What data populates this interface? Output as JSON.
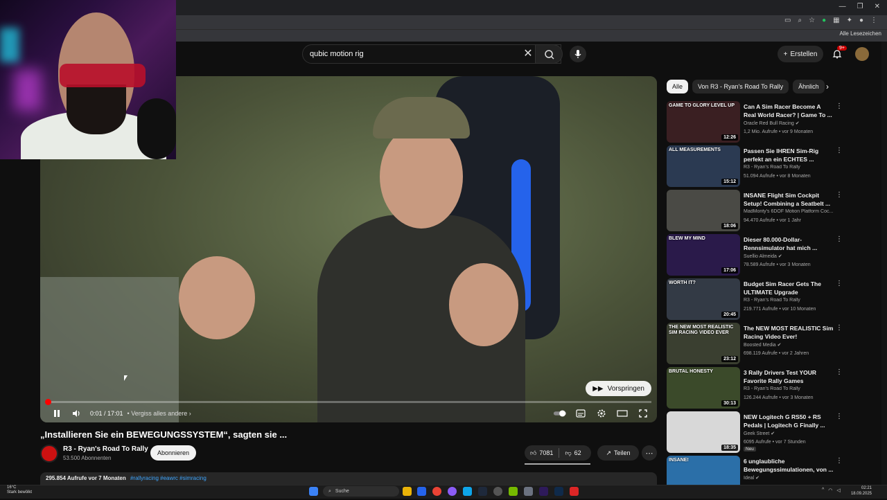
{
  "browser": {
    "bookmarks_label": "Alle Lesezeichen"
  },
  "header": {
    "search_value": "qubic motion rig",
    "create_label": "Erstellen",
    "notifications_badge": "9+"
  },
  "player": {
    "skip_label": "Vorspringen",
    "time": "0:01 / 17:01",
    "chapter": "• Vergiss alles andere",
    "progress": 0.001
  },
  "video": {
    "title": "„Installieren Sie ein BEWEGUNGSSYSTEM“, sagten sie ...",
    "channel_name": "R3 - Ryan's Road To Rally",
    "subscribers": "53.500 Abonnenten",
    "subscribe_label": "Abonnieren",
    "likes": "7081",
    "dislikes": "62",
    "share_label": "Teilen",
    "views": "295.854 Aufrufe  vor 7 Monaten",
    "tags": "#rallyracing #eawrc #simracing"
  },
  "chips": [
    {
      "label": "Alle",
      "active": true
    },
    {
      "label": "Von R3 - Ryan's Road To Rally",
      "active": false
    },
    {
      "label": "Ähnlich",
      "active": false
    }
  ],
  "recommendations": [
    {
      "title": "Can A Sim Racer Become A Real World Racer? | Game To ...",
      "channel": "Oracle Red Bull Racing",
      "verified": true,
      "meta": "1,2 Mio. Aufrufe • vor 9 Monaten",
      "duration": "12:26",
      "thumb_text": "GAME TO GLORY LEVEL UP",
      "thumb_color": "#3a1f22",
      "new": ""
    },
    {
      "title": "Passen Sie IHREN Sim-Rig perfekt an ein ECHTES ...",
      "channel": "R3 - Ryan's Road To Rally",
      "verified": false,
      "meta": "51.094 Aufrufe • vor 8 Monaten",
      "duration": "15:12",
      "thumb_text": "ALL MEASUREMENTS",
      "thumb_color": "#2b3a52",
      "new": ""
    },
    {
      "title": "INSANE Flight Sim Cockpit Setup! Combining a Seatbelt ...",
      "channel": "MadMonty's 6DOF Motion Platform Coc...",
      "verified": false,
      "meta": "94.470 Aufrufe • vor 1 Jahr",
      "duration": "18:06",
      "thumb_text": "",
      "thumb_color": "#4a4a45",
      "new": ""
    },
    {
      "title": "Dieser 80.000-Dollar-Rennsimulator hat mich ...",
      "channel": "Suellio Almeida",
      "verified": true,
      "meta": "78.589 Aufrufe • vor 3 Monaten",
      "duration": "17:06",
      "thumb_text": "BLEW MY MIND",
      "thumb_color": "#2a1a4a",
      "new": ""
    },
    {
      "title": "Budget Sim Racer Gets The ULTIMATE Upgrade",
      "channel": "R3 - Ryan's Road To Rally",
      "verified": false,
      "meta": "219.771 Aufrufe • vor 10 Monaten",
      "duration": "20:45",
      "thumb_text": "WORTH IT?",
      "thumb_color": "#333a45",
      "new": ""
    },
    {
      "title": "The NEW MOST REALISTIC Sim Racing Video Ever!",
      "channel": "Boosted Media",
      "verified": true,
      "meta": "698.119 Aufrufe • vor 2 Jahren",
      "duration": "23:12",
      "thumb_text": "THE NEW MOST REALISTIC SIM RACING VIDEO EVER",
      "thumb_color": "#3a3f30",
      "new": ""
    },
    {
      "title": "3 Rally Drivers Test YOUR Favorite Rally Games",
      "channel": "R3 - Ryan's Road To Rally",
      "verified": false,
      "meta": "126.244 Aufrufe • vor 3 Monaten",
      "duration": "30:13",
      "thumb_text": "BRUTAL HONESTY",
      "thumb_color": "#3b4a2a",
      "new": ""
    },
    {
      "title": "NEW Logitech G RS50 + RS Pedals | Logitech G Finally ...",
      "channel": "Geek Street",
      "verified": true,
      "meta": "6095 Aufrufe • vor 7 Stunden",
      "duration": "18:35",
      "thumb_text": "",
      "thumb_color": "#d8d8d8",
      "new": "Neu"
    },
    {
      "title": "6 unglaubliche Bewegungssimulationen, von ...",
      "channel": "Ideal",
      "verified": true,
      "meta": "",
      "duration": "",
      "thumb_text": "INSANE!",
      "thumb_color": "#2b6fa8",
      "new": ""
    }
  ],
  "taskbar": {
    "weather_temp": "16°C",
    "weather_desc": "Stark bewölkt",
    "search_label": "Suche",
    "time": "02:21",
    "date": "18.09.2025"
  },
  "colors": {
    "accent_red": "#ff0000",
    "background": "#0f0f0f",
    "chip_bg": "#272727"
  }
}
